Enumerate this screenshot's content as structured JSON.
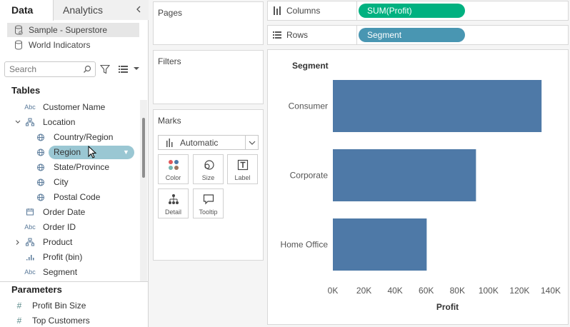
{
  "data_pane": {
    "tabs": {
      "data": "Data",
      "analytics": "Analytics"
    },
    "datasources": [
      {
        "label": "Sample - Superstore",
        "selected": true
      },
      {
        "label": "World Indicators",
        "selected": false
      }
    ],
    "search": {
      "placeholder": "Search"
    },
    "tables_title": "Tables",
    "fields": [
      {
        "label": "Customer Name",
        "type_icon": "Abc",
        "level": 1,
        "expander": ""
      },
      {
        "label": "Location",
        "type_icon": "hierarchy-icon",
        "level": 1,
        "expander": "⌄"
      },
      {
        "label": "Country/Region",
        "type_icon": "globe-icon",
        "level": 2,
        "expander": ""
      },
      {
        "label": "Region",
        "type_icon": "globe-icon",
        "level": 2,
        "expander": "",
        "dragging": true
      },
      {
        "label": "State/Province",
        "type_icon": "globe-icon",
        "level": 2,
        "expander": ""
      },
      {
        "label": "City",
        "type_icon": "globe-icon",
        "level": 2,
        "expander": ""
      },
      {
        "label": "Postal Code",
        "type_icon": "globe-icon",
        "level": 2,
        "expander": ""
      },
      {
        "label": "Order Date",
        "type_icon": "calendar-icon",
        "level": 1,
        "expander": ""
      },
      {
        "label": "Order ID",
        "type_icon": "Abc",
        "level": 1,
        "expander": ""
      },
      {
        "label": "Product",
        "type_icon": "hierarchy-icon",
        "level": 1,
        "expander": "›"
      },
      {
        "label": "Profit (bin)",
        "type_icon": "bin-icon",
        "level": 1,
        "expander": ""
      },
      {
        "label": "Segment",
        "type_icon": "Abc",
        "level": 1,
        "expander": ""
      }
    ],
    "parameters_title": "Parameters",
    "parameters": [
      {
        "label": "Profit Bin Size",
        "type_icon": "#"
      },
      {
        "label": "Top Customers",
        "type_icon": "#"
      }
    ]
  },
  "cards": {
    "pages": "Pages",
    "filters": "Filters",
    "marks": {
      "title": "Marks",
      "mark_type": "Automatic",
      "buttons": [
        "Color",
        "Size",
        "Label",
        "Detail",
        "Tooltip"
      ]
    }
  },
  "shelves": {
    "columns": {
      "label": "Columns",
      "pill": "SUM(Profit)"
    },
    "rows": {
      "label": "Rows",
      "pill": "Segment"
    }
  },
  "colors": {
    "measure_pill": "#00b180",
    "dimension_pill": "#4996b2",
    "bar": "#4e79a7",
    "drag_pill": "#9ac7d3"
  },
  "chart_data": {
    "type": "bar",
    "orientation": "horizontal",
    "row_header": "Segment",
    "categories": [
      "Consumer",
      "Corporate",
      "Home Office"
    ],
    "values": [
      134119,
      91979,
      60299
    ],
    "xlabel": "Profit",
    "xlim": [
      0,
      140000
    ],
    "x_ticks": [
      "0K",
      "20K",
      "40K",
      "60K",
      "80K",
      "100K",
      "120K",
      "140K"
    ],
    "grid": false
  }
}
